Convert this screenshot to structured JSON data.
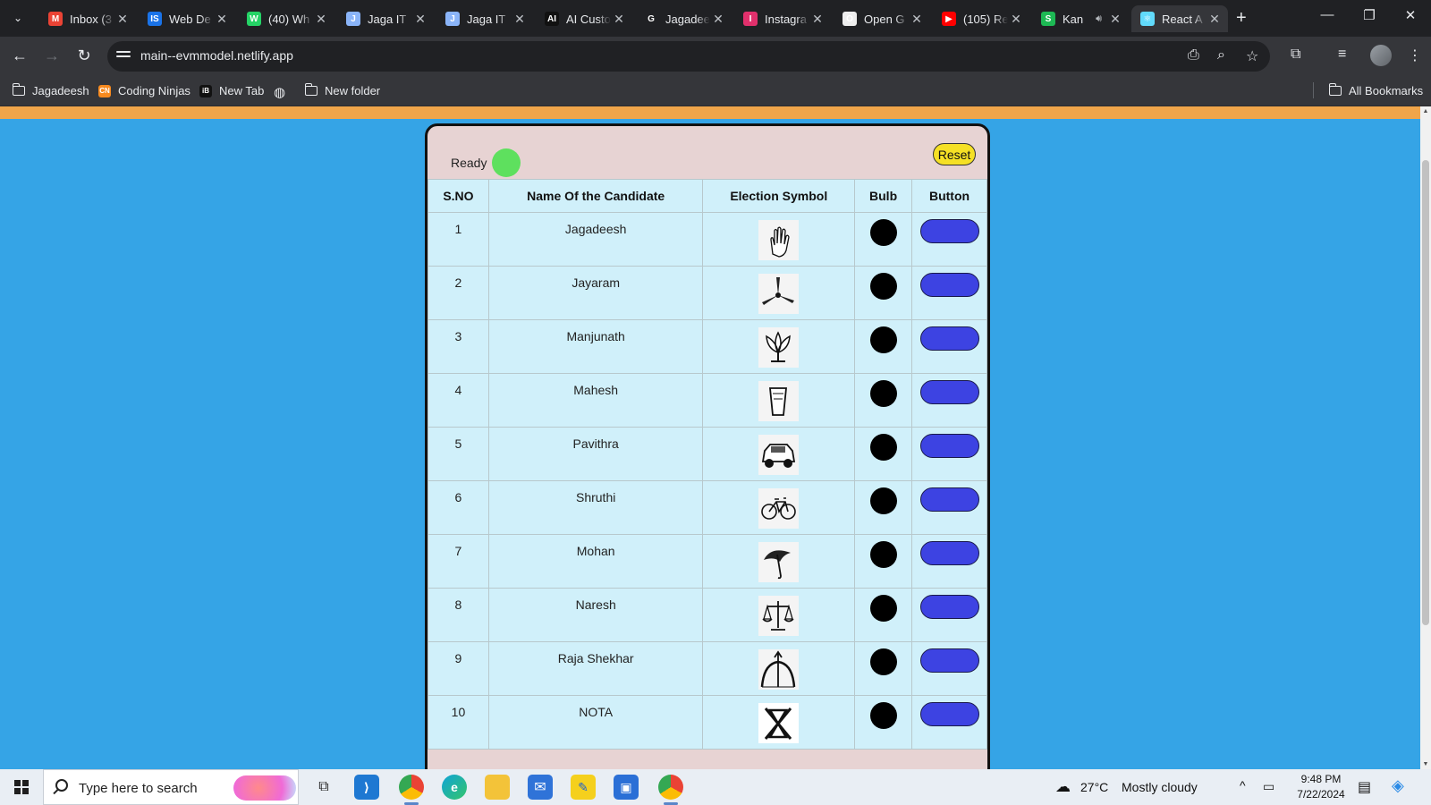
{
  "browser": {
    "tabs": [
      {
        "title": "Inbox (3",
        "icon": "gmail-icon",
        "color": "#ea4335",
        "glyph": "M"
      },
      {
        "title": "Web De",
        "icon": "web-dev-icon",
        "color": "#1a73e8",
        "glyph": "IS"
      },
      {
        "title": "(40) Wh",
        "icon": "whatsapp-icon",
        "color": "#25d366",
        "glyph": "W"
      },
      {
        "title": "Jaga IT",
        "icon": "site-icon",
        "color": "#8ab4f8",
        "glyph": "J"
      },
      {
        "title": "Jaga IT",
        "icon": "site-icon",
        "color": "#8ab4f8",
        "glyph": "J"
      },
      {
        "title": "AI Custo",
        "icon": "ai-site-icon",
        "color": "#111111",
        "glyph": "AI"
      },
      {
        "title": "Jagadee",
        "icon": "github-icon",
        "color": "#202124",
        "glyph": "G"
      },
      {
        "title": "Instagra",
        "icon": "instagram-icon",
        "color": "#e1306c",
        "glyph": "I"
      },
      {
        "title": "Open G",
        "icon": "openai-icon",
        "color": "#eeeeee",
        "glyph": "O"
      },
      {
        "title": "(105) Re",
        "icon": "youtube-icon",
        "color": "#ff0000",
        "glyph": "▶"
      },
      {
        "title": "Kan",
        "icon": "spotify-icon",
        "color": "#1db954",
        "glyph": "S"
      },
      {
        "title": "React A",
        "icon": "react-icon",
        "color": "#61dafb",
        "glyph": "⚛"
      }
    ],
    "url": "main--evmmodel.netlify.app",
    "bookmarks": [
      "Jagadeesh",
      "Coding Ninjas",
      "New Tab",
      "New folder"
    ],
    "all_bookmarks": "All Bookmarks"
  },
  "evm": {
    "status": "Ready",
    "status_color": "#5ee05e",
    "reset_label": "Reset",
    "headers": [
      "S.NO",
      "Name Of the Candidate",
      "Election Symbol",
      "Bulb",
      "Button"
    ],
    "candidates": [
      {
        "sno": "1",
        "name": "Jagadeesh",
        "symbol": "hand-symbol"
      },
      {
        "sno": "2",
        "name": "Jayaram",
        "symbol": "fan-symbol"
      },
      {
        "sno": "3",
        "name": "Manjunath",
        "symbol": "lotus-symbol"
      },
      {
        "sno": "4",
        "name": "Mahesh",
        "symbol": "glass-symbol"
      },
      {
        "sno": "5",
        "name": "Pavithra",
        "symbol": "car-symbol"
      },
      {
        "sno": "6",
        "name": "Shruthi",
        "symbol": "bicycle-symbol"
      },
      {
        "sno": "7",
        "name": "Mohan",
        "symbol": "umbrella-symbol"
      },
      {
        "sno": "8",
        "name": "Naresh",
        "symbol": "scales-symbol"
      },
      {
        "sno": "9",
        "name": "Raja Shekhar",
        "symbol": "bow-arrow-symbol"
      },
      {
        "sno": "10",
        "name": "NOTA",
        "symbol": "nota-symbol"
      }
    ],
    "bulb_color": "#000000",
    "button_color": "#3d43e2"
  },
  "taskbar": {
    "search_placeholder": "Type here to search",
    "weather_temp": "27°C",
    "weather_text": "Mostly cloudy",
    "time": "9:48 PM",
    "date": "7/22/2024"
  }
}
